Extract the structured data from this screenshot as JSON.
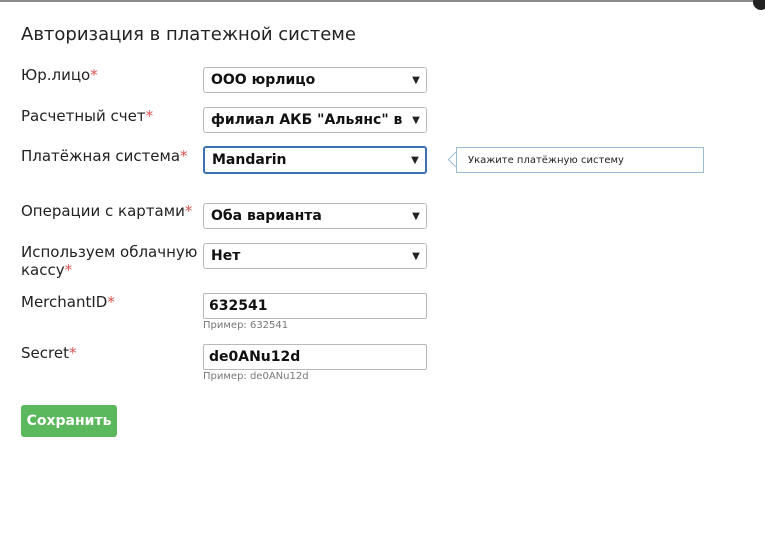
{
  "title": "Авторизация в платежной системе",
  "required_mark": "*",
  "fields": {
    "legal_entity": {
      "label": "Юр.лицо",
      "value": "ООО юрлицо"
    },
    "account": {
      "label": "Расчетный счет",
      "value": "филиал АКБ \"Альянс\" в г. Москве"
    },
    "payment_system": {
      "label": "Платёжная система",
      "value": "Mandarin",
      "tooltip": "Укажите платёжную систему"
    },
    "card_operations": {
      "label": "Операции с картами",
      "value": "Оба варианта"
    },
    "cloud_register": {
      "label_line1": "Используем облачную",
      "label_line2": "кассу",
      "value": "Нет"
    },
    "merchant_id": {
      "label": "MerchantID",
      "value": "632541",
      "hint": "Пример: 632541"
    },
    "secret": {
      "label": "Secret",
      "value": "de0ANu12d",
      "hint": "Пример: de0ANu12d"
    }
  },
  "save_button": "Сохранить",
  "icons": {
    "dropdown": "chevron-down-icon"
  },
  "colors": {
    "accent_button": "#5cb85c",
    "required": "#d9534f",
    "focus": "#3b6fb0"
  }
}
